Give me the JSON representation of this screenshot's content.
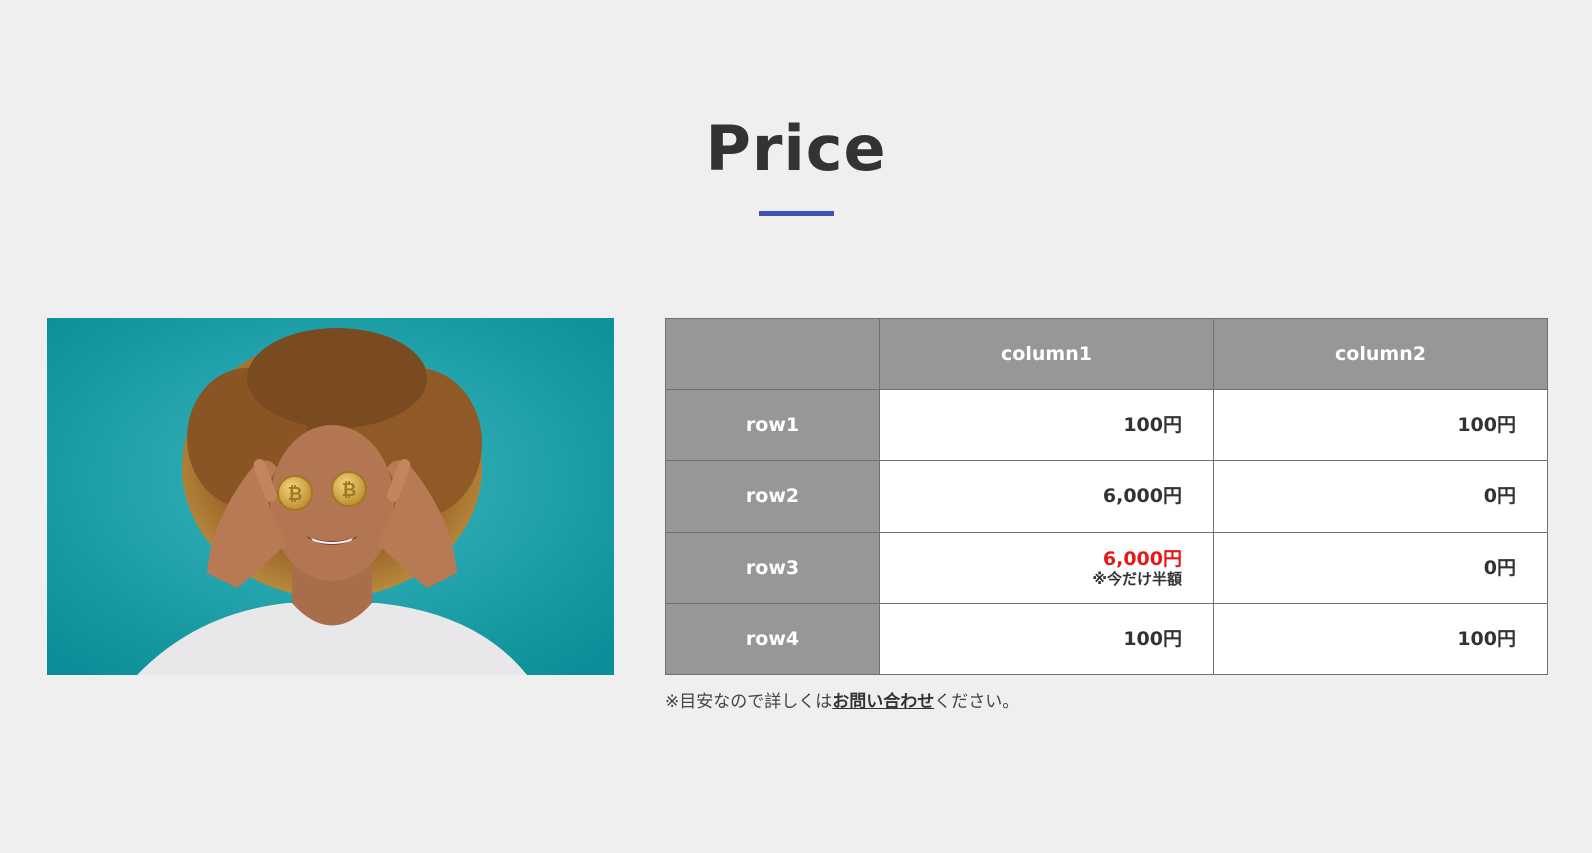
{
  "section": {
    "title": "Price"
  },
  "colors": {
    "accent": "#3f51b5",
    "header_bg": "#979797",
    "highlight": "#e61919"
  },
  "table": {
    "columns": [
      "",
      "column1",
      "column2"
    ],
    "rows": [
      {
        "label": "row1",
        "col1": "100円",
        "col1_note": "",
        "col2": "100円"
      },
      {
        "label": "row2",
        "col1": "6,000円",
        "col1_note": "",
        "col2": "0円"
      },
      {
        "label": "row3",
        "col1": "6,000円",
        "col1_note": "※今だけ半額",
        "col2": "0円"
      },
      {
        "label": "row4",
        "col1": "100円",
        "col1_note": "",
        "col2": "100円"
      }
    ]
  },
  "note": {
    "prefix": "※目安なので詳しくは",
    "link": "お問い合わせ",
    "suffix": "ください。"
  }
}
